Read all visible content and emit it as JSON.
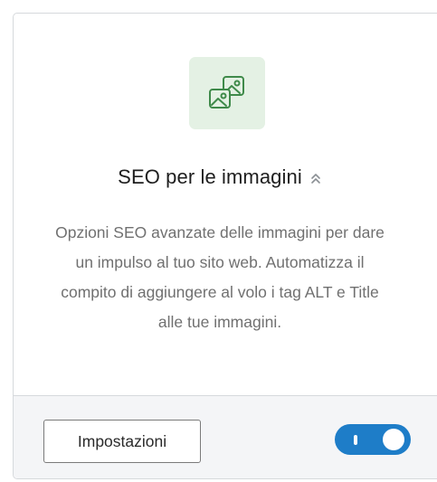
{
  "card": {
    "icon": "images-icon",
    "title": "SEO per le immagini",
    "collapse_icon": "chevron-double-up-icon",
    "description": "Opzioni SEO avanzate delle immagini per dare un impulso al tuo sito web. Automatizza il compito di aggiungere al volo i tag ALT e Title alle tue immagini.",
    "settings_button_label": "Impostazioni",
    "toggle_state": "on"
  },
  "colors": {
    "icon_background": "#e4f1e4",
    "icon_stroke": "#3f8a4a",
    "toggle_on": "#1e7dc8",
    "footer_background": "#f4f5f7"
  }
}
